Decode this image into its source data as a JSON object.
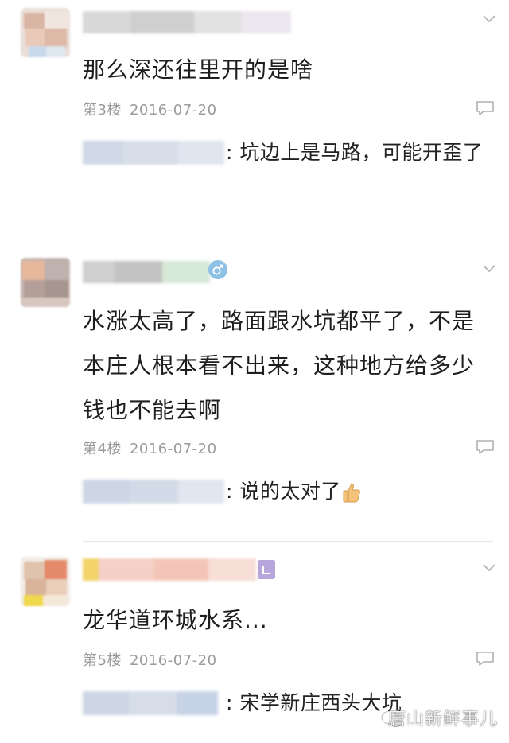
{
  "comments": [
    {
      "text": "那么深还往里开的是啥",
      "floor": "第3楼",
      "date": "2016-07-20",
      "reply_text": ": 坑边上是马路，可能开歪了"
    },
    {
      "text": "水涨太高了，路面跟水坑都平了，不是本庄人根本看不出来，这种地方给多少钱也不能去啊",
      "floor": "第4楼",
      "date": "2016-07-20",
      "reply_text": ": 说的太对了"
    },
    {
      "text": "龙华道环城水系...",
      "floor": "第5楼",
      "date": "2016-07-20",
      "reply_text": ": 宋学新庄西头大坑"
    }
  ],
  "icons": {
    "chevron": "chevron-down-icon",
    "reply": "reply-icon",
    "gender": "male-gender-icon",
    "thumb": "thumbs-up-icon"
  },
  "colors": {
    "meta_gray": "#9a9a9a",
    "divider": "#e6e6e6",
    "gender_blue": "#8ec1e6"
  },
  "watermark": "唐山新鲜事儿"
}
